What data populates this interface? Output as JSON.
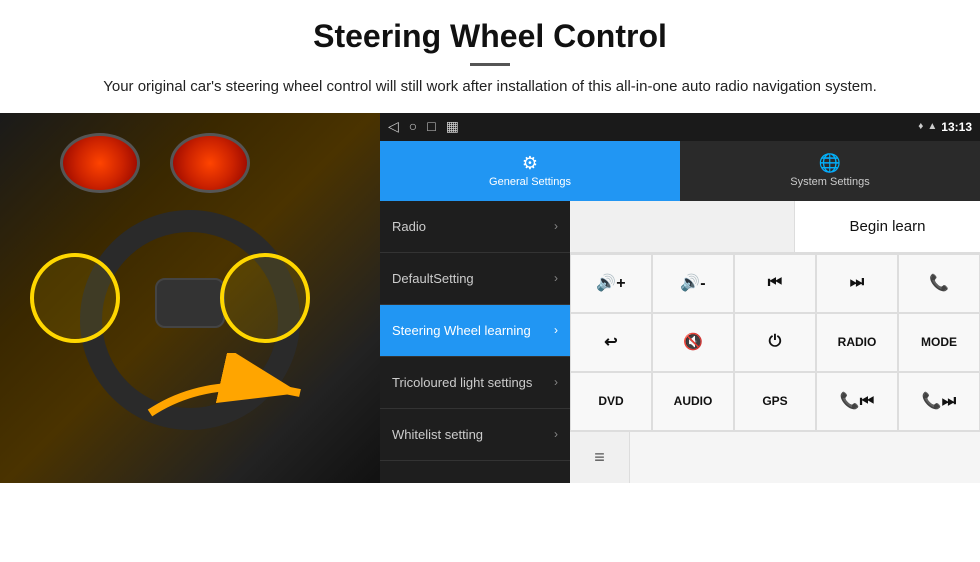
{
  "header": {
    "title": "Steering Wheel Control",
    "subtitle": "Your original car's steering wheel control will still work after installation of this all-in-one auto radio navigation system."
  },
  "status_bar": {
    "nav_back": "◁",
    "nav_home": "○",
    "nav_recent": "□",
    "nav_cast": "▦",
    "location_icon": "♦",
    "signal_icon": "▲",
    "time": "13:13"
  },
  "tabs": {
    "general": {
      "label": "General Settings",
      "icon": "⚙"
    },
    "system": {
      "label": "System Settings",
      "icon": "🌐"
    }
  },
  "menu": {
    "items": [
      {
        "label": "Radio",
        "active": false
      },
      {
        "label": "DefaultSetting",
        "active": false
      },
      {
        "label": "Steering Wheel learning",
        "active": true
      },
      {
        "label": "Tricoloured light settings",
        "active": false
      },
      {
        "label": "Whitelist setting",
        "active": false
      }
    ]
  },
  "controls": {
    "begin_learn_label": "Begin learn",
    "buttons": [
      {
        "label": "🔊+",
        "row": 1,
        "col": 1
      },
      {
        "label": "🔊-",
        "row": 1,
        "col": 2
      },
      {
        "label": "⏮",
        "row": 1,
        "col": 3
      },
      {
        "label": "⏭",
        "row": 1,
        "col": 4
      },
      {
        "label": "📞",
        "row": 1,
        "col": 5
      },
      {
        "label": "↩",
        "row": 2,
        "col": 1
      },
      {
        "label": "🔇",
        "row": 2,
        "col": 2
      },
      {
        "label": "⏻",
        "row": 2,
        "col": 3
      },
      {
        "label": "RADIO",
        "row": 2,
        "col": 4
      },
      {
        "label": "MODE",
        "row": 2,
        "col": 5
      },
      {
        "label": "DVD",
        "row": 3,
        "col": 1
      },
      {
        "label": "AUDIO",
        "row": 3,
        "col": 2
      },
      {
        "label": "GPS",
        "row": 3,
        "col": 3
      },
      {
        "label": "📞⏮",
        "row": 3,
        "col": 4
      },
      {
        "label": "📞⏭",
        "row": 3,
        "col": 5
      }
    ],
    "scan_icon": "≡"
  }
}
